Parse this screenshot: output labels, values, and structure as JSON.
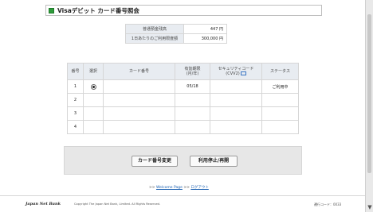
{
  "header": {
    "title": "Visaデビット カード番号照会"
  },
  "balance": {
    "rows": [
      {
        "label": "普通預金残高",
        "value": "447 円"
      },
      {
        "label": "1日あたりのご利用限度額",
        "value": "300,000 円"
      }
    ]
  },
  "cards_table": {
    "headers": {
      "no": "番号",
      "select": "選択",
      "card_no": "カード番号",
      "expiry_line1": "有効期限",
      "expiry_line2": "(月/年)",
      "security_line1": "セキュリティコード",
      "security_line2": "(CVV2)",
      "status": "ステータス"
    },
    "rows": [
      {
        "no": "1",
        "selected": true,
        "card_no": "",
        "expiry": "05/18",
        "security": "",
        "status": "ご利用中"
      },
      {
        "no": "2",
        "selected": false,
        "card_no": "",
        "expiry": "",
        "security": "",
        "status": ""
      },
      {
        "no": "3",
        "selected": false,
        "card_no": "",
        "expiry": "",
        "security": "",
        "status": ""
      },
      {
        "no": "4",
        "selected": false,
        "card_no": "",
        "expiry": "",
        "security": "",
        "status": ""
      }
    ]
  },
  "actions": {
    "change_card_label": "カード番号変更",
    "suspend_label": "利用停止/再開"
  },
  "links": {
    "prefix1": ">>",
    "welcome": "Welcome Page",
    "prefix2": ">>",
    "logout": "ログアウト"
  },
  "footer": {
    "logo": "Japan Net Bank",
    "copyright": "Copyright The Japan Net Bank, Limited. All Rights Reserved.",
    "code": "遷行コード：0033"
  },
  "colors": {
    "accent_green": "#2e9b3a",
    "header_bg": "#e8ecf1",
    "link": "#1a5fb0"
  },
  "icons": {
    "title_marker": "green-square-icon",
    "cvv_help": "info-card-icon",
    "scroll_down": "chevron-down-icon"
  }
}
